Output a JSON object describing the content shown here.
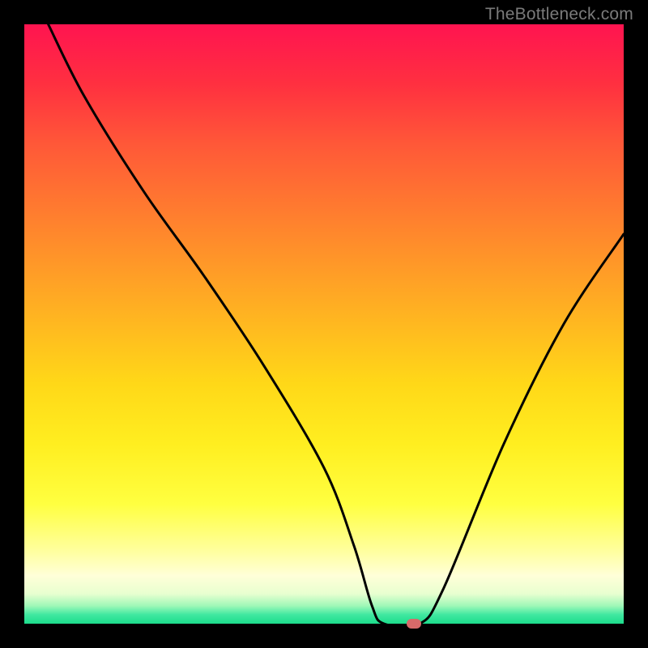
{
  "watermark": "TheBottleneck.com",
  "chart_data": {
    "type": "line",
    "title": "",
    "xlabel": "",
    "ylabel": "",
    "xlim": [
      0,
      100
    ],
    "ylim": [
      0,
      100
    ],
    "series": [
      {
        "name": "curve",
        "x": [
          4,
          10,
          20,
          30,
          40,
          50,
          55,
          58,
          60,
          66,
          70,
          80,
          90,
          100
        ],
        "values": [
          100,
          88,
          72,
          58,
          43,
          26,
          13,
          3,
          0,
          0,
          6,
          30,
          50,
          65
        ]
      }
    ],
    "marker": {
      "x": 65,
      "y": 0,
      "color": "#d86a6a"
    },
    "gradient_colors": {
      "top": "#ff1450",
      "mid": "#ffee20",
      "bottom": "#1cdc8c"
    }
  }
}
